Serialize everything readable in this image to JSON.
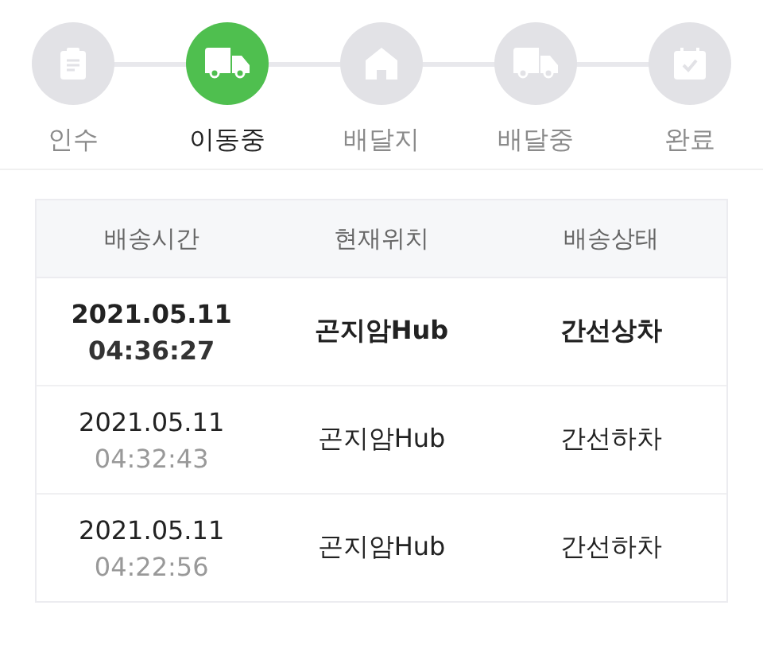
{
  "steps": [
    {
      "label": "인수",
      "kind": "clipboard",
      "selected": false
    },
    {
      "label": "이동중",
      "kind": "truck",
      "selected": true
    },
    {
      "label": "배달지",
      "kind": "house",
      "selected": false
    },
    {
      "label": "배달중",
      "kind": "truck",
      "selected": false
    },
    {
      "label": "완료",
      "kind": "check",
      "selected": false
    }
  ],
  "table": {
    "columns": [
      "배송시간",
      "현재위치",
      "배송상태"
    ],
    "rows": [
      {
        "date": "2021.05.11",
        "time": "04:36:27",
        "location": "곤지암Hub",
        "status": "간선상차",
        "latest": true
      },
      {
        "date": "2021.05.11",
        "time": "04:32:43",
        "location": "곤지암Hub",
        "status": "간선하차",
        "latest": false
      },
      {
        "date": "2021.05.11",
        "time": "04:22:56",
        "location": "곤지암Hub",
        "status": "간선하차",
        "latest": false
      }
    ]
  }
}
